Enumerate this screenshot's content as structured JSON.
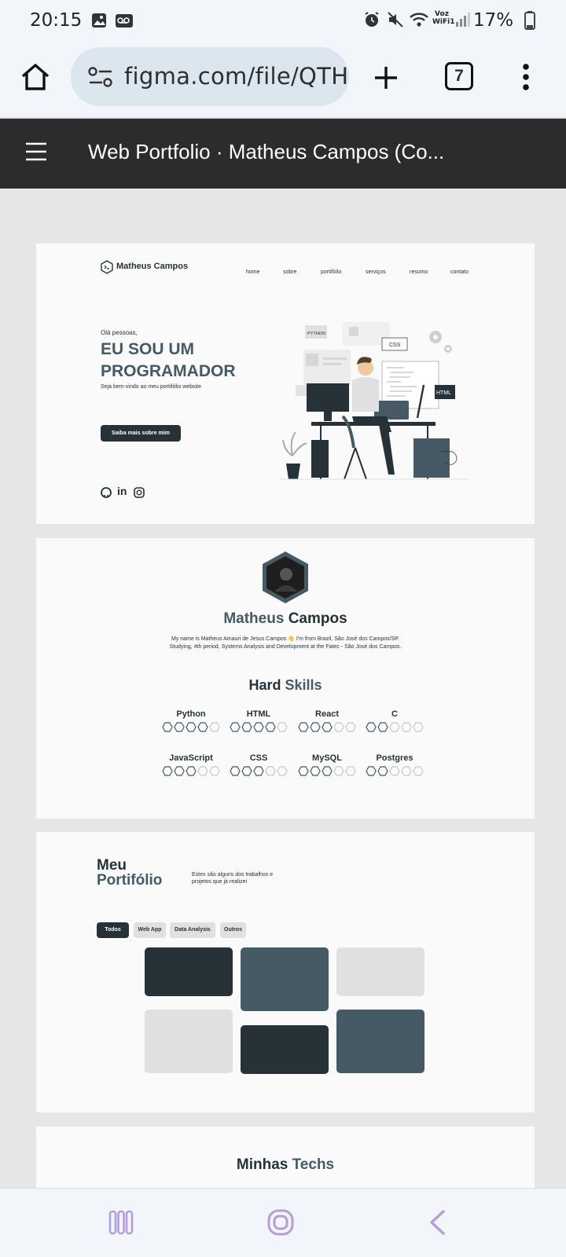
{
  "status": {
    "time": "20:15",
    "network": "Voz WiFi1",
    "battery": "17%"
  },
  "browser": {
    "url": "figma.com/file/QTH(",
    "tab_count": "7"
  },
  "figma": {
    "title": "Web Portfolio · Matheus Campos (Co..."
  },
  "hero": {
    "logo_name": "Matheus Campos",
    "nav": [
      "home",
      "sobre",
      "portifólio",
      "serviços",
      "resumo",
      "contato"
    ],
    "greeting": "Olá pessoas,",
    "headline_1": "EU SOU UM",
    "headline_2": "PROGRAMADOR",
    "subtitle": "Seja bem-vindo ao meu portifólio website",
    "cta": "Saiba mais sobre mim",
    "illustration_labels": {
      "python": "PYTHON",
      "css": "CSS",
      "html": "HTML"
    },
    "socials": [
      "github-icon",
      "linkedin-icon",
      "instagram-icon"
    ],
    "linkedin_text": "in"
  },
  "about": {
    "name_first": "Matheus",
    "name_last": "Campos",
    "bio_1": "My name is Matheus Amauri de Jesus Campos 👋 I'm from Brazil, São José dos Campos/SP.",
    "bio_2": "Studying, 4th period, Systems Analysis and Development at the Fatec - São José dos Campos.",
    "skills_title_1": "Hard",
    "skills_title_2": "Skills",
    "skills": [
      {
        "name": "Python",
        "level": 4
      },
      {
        "name": "HTML",
        "level": 4
      },
      {
        "name": "React",
        "level": 3
      },
      {
        "name": "C",
        "level": 2
      },
      {
        "name": "JavaScript",
        "level": 3
      },
      {
        "name": "CSS",
        "level": 3
      },
      {
        "name": "MySQL",
        "level": 3
      },
      {
        "name": "Postgres",
        "level": 2
      }
    ],
    "skills_max": 5
  },
  "portfolio": {
    "title_1": "Meu",
    "title_2": "Portifólio",
    "desc_1": "Estes são alguns dos trabalhos e",
    "desc_2": "projetos que já realizei",
    "filters": [
      "Todos",
      "Web App",
      "Data Analysis",
      "Outros"
    ],
    "active_filter": "Todos"
  },
  "techs": {
    "title_1": "Minhas",
    "title_2": "Techs"
  },
  "colors": {
    "dark": "#263238",
    "slate": "#455a64",
    "light": "#e0e0e0",
    "figma_bar": "#2c2c2c",
    "nav_icon": "#b39ddb"
  }
}
